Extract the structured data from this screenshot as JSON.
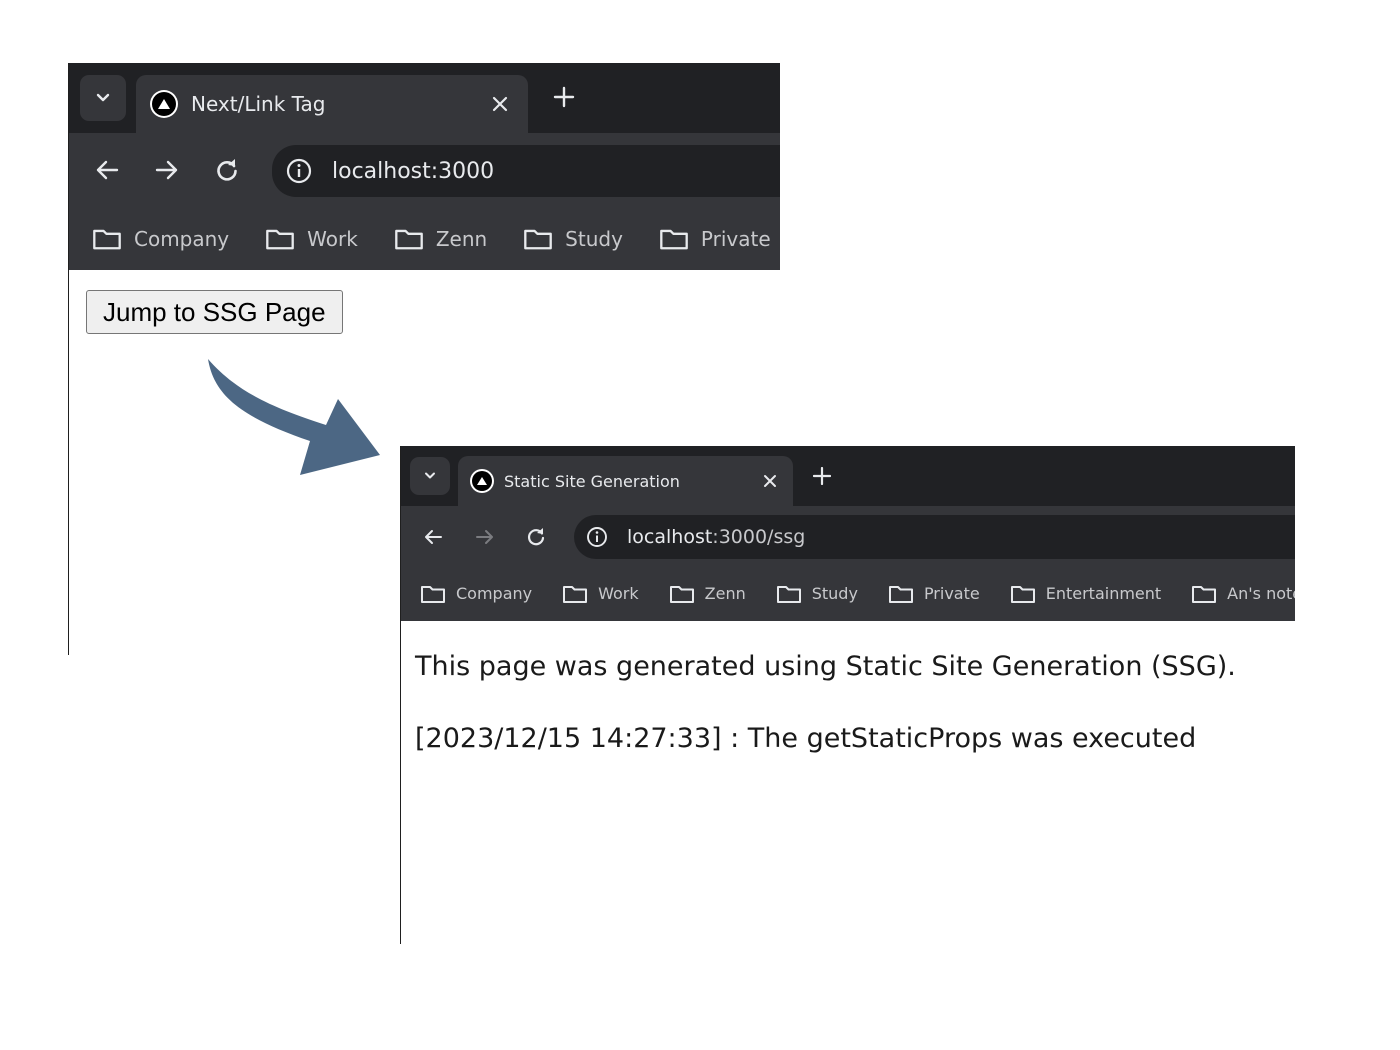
{
  "colors": {
    "tab_strip": "#202124",
    "toolbar": "#35363a",
    "omnibox": "#202124",
    "text_light": "#e8eaed",
    "text_bookmark": "#c8c9cc",
    "arrow": "#4c6784"
  },
  "window1": {
    "tab": {
      "favicon": "nextjs-logo-icon",
      "title": "Next/Link Tag",
      "close_icon": "close-icon"
    },
    "new_tab_icon": "plus-icon",
    "nav": {
      "back_icon": "arrow-left-icon",
      "forward_icon": "arrow-right-icon",
      "reload_icon": "reload-icon"
    },
    "address": {
      "info_icon": "info-icon",
      "url": "localhost:3000"
    },
    "bookmarks": [
      {
        "icon": "folder-icon",
        "label": "Company"
      },
      {
        "icon": "folder-icon",
        "label": "Work"
      },
      {
        "icon": "folder-icon",
        "label": "Zenn"
      },
      {
        "icon": "folder-icon",
        "label": "Study"
      },
      {
        "icon": "folder-icon",
        "label": "Private"
      }
    ],
    "content": {
      "button_label": "Jump to SSG Page"
    }
  },
  "transition_arrow_icon": "curved-arrow-icon",
  "window2": {
    "tab": {
      "favicon": "nextjs-logo-icon",
      "title": "Static Site Generation",
      "close_icon": "close-icon"
    },
    "new_tab_icon": "plus-icon",
    "nav": {
      "back_icon": "arrow-left-icon",
      "forward_icon": "arrow-right-icon",
      "forward_disabled": true,
      "reload_icon": "reload-icon"
    },
    "address": {
      "info_icon": "info-icon",
      "url_host": "localhost",
      "url_path": ":3000/ssg"
    },
    "bookmarks": [
      {
        "icon": "folder-icon",
        "label": "Company"
      },
      {
        "icon": "folder-icon",
        "label": "Work"
      },
      {
        "icon": "folder-icon",
        "label": "Zenn"
      },
      {
        "icon": "folder-icon",
        "label": "Study"
      },
      {
        "icon": "folder-icon",
        "label": "Private"
      },
      {
        "icon": "folder-icon",
        "label": "Entertainment"
      },
      {
        "icon": "folder-icon",
        "label": "An's note"
      }
    ],
    "content": {
      "line1": "This page was generated using Static Site Generation (SSG).",
      "line2": "[2023/12/15 14:27:33] : The getStaticProps was executed"
    }
  }
}
